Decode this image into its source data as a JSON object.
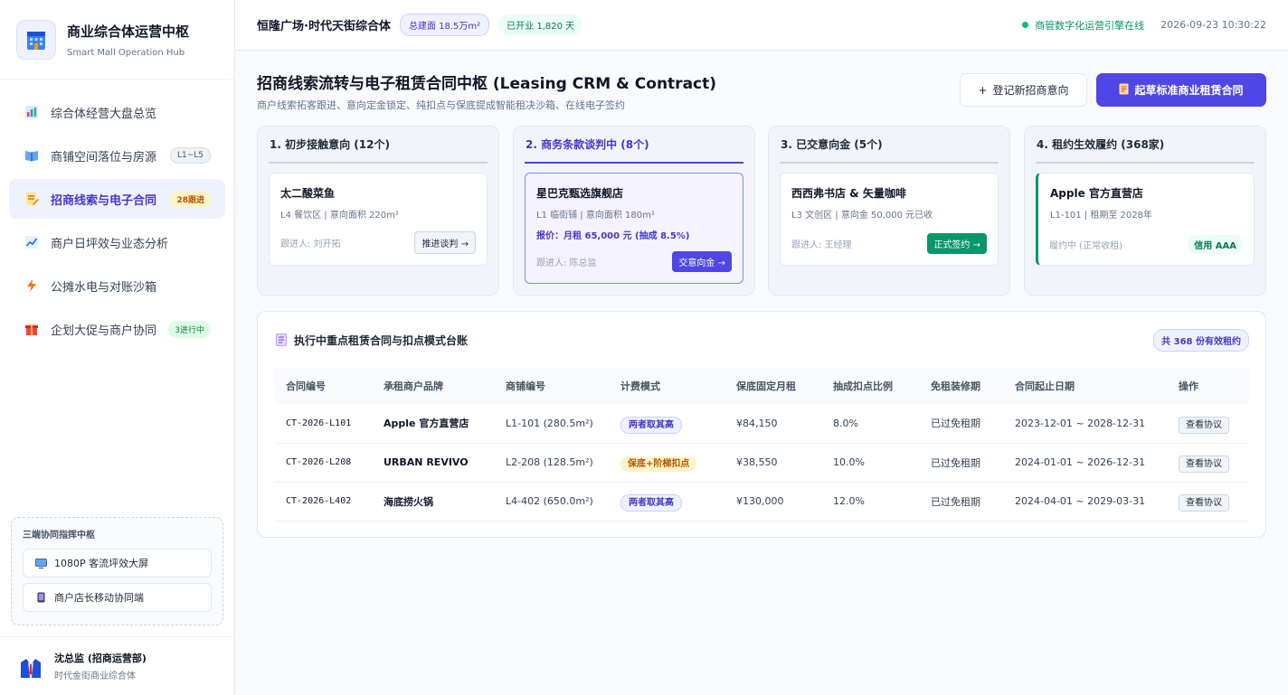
{
  "brand": {
    "title": "商业综合体运营中枢",
    "subtitle": "Smart Mall Operation Hub",
    "icon": "mall-building-icon"
  },
  "sidebar": {
    "items": [
      {
        "label": "综合体经营大盘总览",
        "icon": "chart-bar-icon",
        "badge": "",
        "active": false
      },
      {
        "label": "商铺空间落位与房源",
        "icon": "map-book-icon",
        "badge": "L1~L5",
        "active": false
      },
      {
        "label": "招商线索与电子合同",
        "icon": "memo-icon",
        "badge": "28跟进",
        "active": true
      },
      {
        "label": "商户日坪效与业态分析",
        "icon": "trend-chart-icon",
        "badge": "",
        "active": false
      },
      {
        "label": "公摊水电与对账沙箱",
        "icon": "lightning-icon",
        "badge": "",
        "active": false
      },
      {
        "label": "企划大促与商户协同",
        "icon": "gift-icon",
        "badge": "3进行中",
        "active": false
      }
    ],
    "hub": {
      "title": "三端协同指挥中枢",
      "buttons": [
        {
          "label": "1080P 客流坪效大屏",
          "icon": "tv-icon"
        },
        {
          "label": "商户店长移动协同端",
          "icon": "mobile-icon"
        }
      ]
    },
    "user": {
      "name": "沈总监 (招商运营部)",
      "org": "时代金街商业综合体"
    }
  },
  "topbar": {
    "mall_name": "恒隆广场·时代天街综合体",
    "area_pill": "总建面 18.5万m²",
    "open_pill": "已开业 1,820 天",
    "status": "商管数字化运营引擎在线",
    "datetime": "2026-09-23 10:30:22"
  },
  "page": {
    "title": "招商线索流转与电子租赁合同中枢 (Leasing CRM & Contract)",
    "subtitle": "商户线索拓客跟进、意向定金锁定、纯扣点与保底提成智能租决沙箱、在线电子签约",
    "btn_register": "登记新招商意向",
    "btn_draft": "起草标准商业租赁合同"
  },
  "kanban": [
    {
      "title": "1. 初步接触意向 (12个)",
      "card": {
        "name": "太二酸菜鱼",
        "meta": "L4 餐饮区 | 意向面积 220m²",
        "quote": "",
        "owner": "跟进人: 刘开拓",
        "action": "推进谈判 →"
      }
    },
    {
      "title": "2. 商务条款谈判中 (8个)",
      "card": {
        "name": "星巴克甄选旗舰店",
        "meta": "L1 临街铺 | 意向面积 180m²",
        "quote": "报价：月租 65,000 元 (抽成 8.5%)",
        "owner": "跟进人: 陈总监",
        "action": "交意向金 →"
      }
    },
    {
      "title": "3. 已交意向金 (5个)",
      "card": {
        "name": "西西弗书店 & 矢量咖啡",
        "meta": "L3 文创区 | 意向金 50,000 元已收",
        "quote": "",
        "owner": "跟进人: 王经理",
        "action": "正式签约 →"
      }
    },
    {
      "title": "4. 租约生效履约 (368家)",
      "card": {
        "name": "Apple 官方直营店",
        "meta": "L1-101 | 租期至 2028年",
        "quote": "",
        "owner": "履约中 (正常收租)",
        "action": "信用 AAA"
      }
    }
  ],
  "ledger": {
    "title": "执行中重点租赁合同与扣点模式台账",
    "count": "共 368 份有效租约",
    "columns": [
      "合同编号",
      "承租商户品牌",
      "商铺编号",
      "计费模式",
      "保底固定月租",
      "抽成扣点比例",
      "免租装修期",
      "合同起止日期",
      "操作"
    ],
    "rows": [
      {
        "id": "CT-2026-L101",
        "brand": "Apple 官方直营店",
        "shop": "L1-101 (280.5m²)",
        "mode": "两者取其高",
        "rent": "¥84,150",
        "rate": "8.0%",
        "free": "已过免租期",
        "period": "2023-12-01 ~ 2028-12-31",
        "op": "查看协议"
      },
      {
        "id": "CT-2026-L208",
        "brand": "URBAN REVIVO",
        "shop": "L2-208 (128.5m²)",
        "mode": "保底+阶梯扣点",
        "rent": "¥38,550",
        "rate": "10.0%",
        "free": "已过免租期",
        "period": "2024-01-01 ~ 2026-12-31",
        "op": "查看协议"
      },
      {
        "id": "CT-2026-L402",
        "brand": "海底捞火锅",
        "shop": "L4-402 (650.0m²)",
        "mode": "两者取其高",
        "rent": "¥130,000",
        "rate": "12.0%",
        "free": "已过免租期",
        "period": "2024-04-01 ~ 2029-03-31",
        "op": "查看协议"
      }
    ]
  },
  "colors": {
    "accent": "#4f46e5",
    "success": "#059669",
    "warning": "#b45309"
  }
}
